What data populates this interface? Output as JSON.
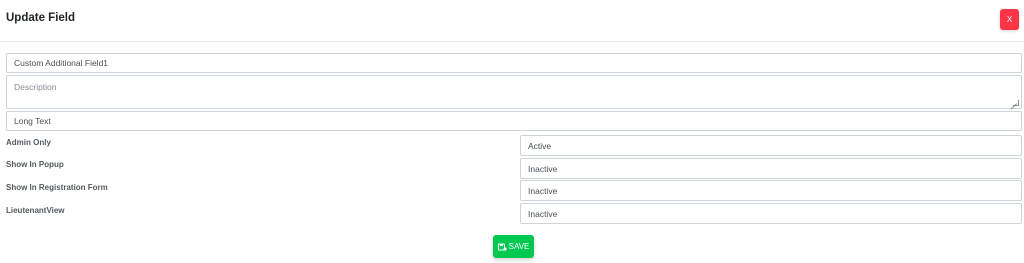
{
  "modal": {
    "title": "Update Field",
    "close_label": "X"
  },
  "form": {
    "name_value": "Custom Additional Field1",
    "description_placeholder": "Description",
    "type_value": "Long Text",
    "settings": [
      {
        "label": "Admin Only",
        "value": "Active"
      },
      {
        "label": "Show In Popup",
        "value": "Inactive"
      },
      {
        "label": "Show In Registration Form",
        "value": "Inactive"
      },
      {
        "label": "LieutenantView",
        "value": "Inactive"
      }
    ]
  },
  "actions": {
    "save_label": "SAVE",
    "save_icon": "save-icon"
  },
  "colors": {
    "close": "#ff3547",
    "save": "#00c851",
    "border": "#ced4da"
  }
}
